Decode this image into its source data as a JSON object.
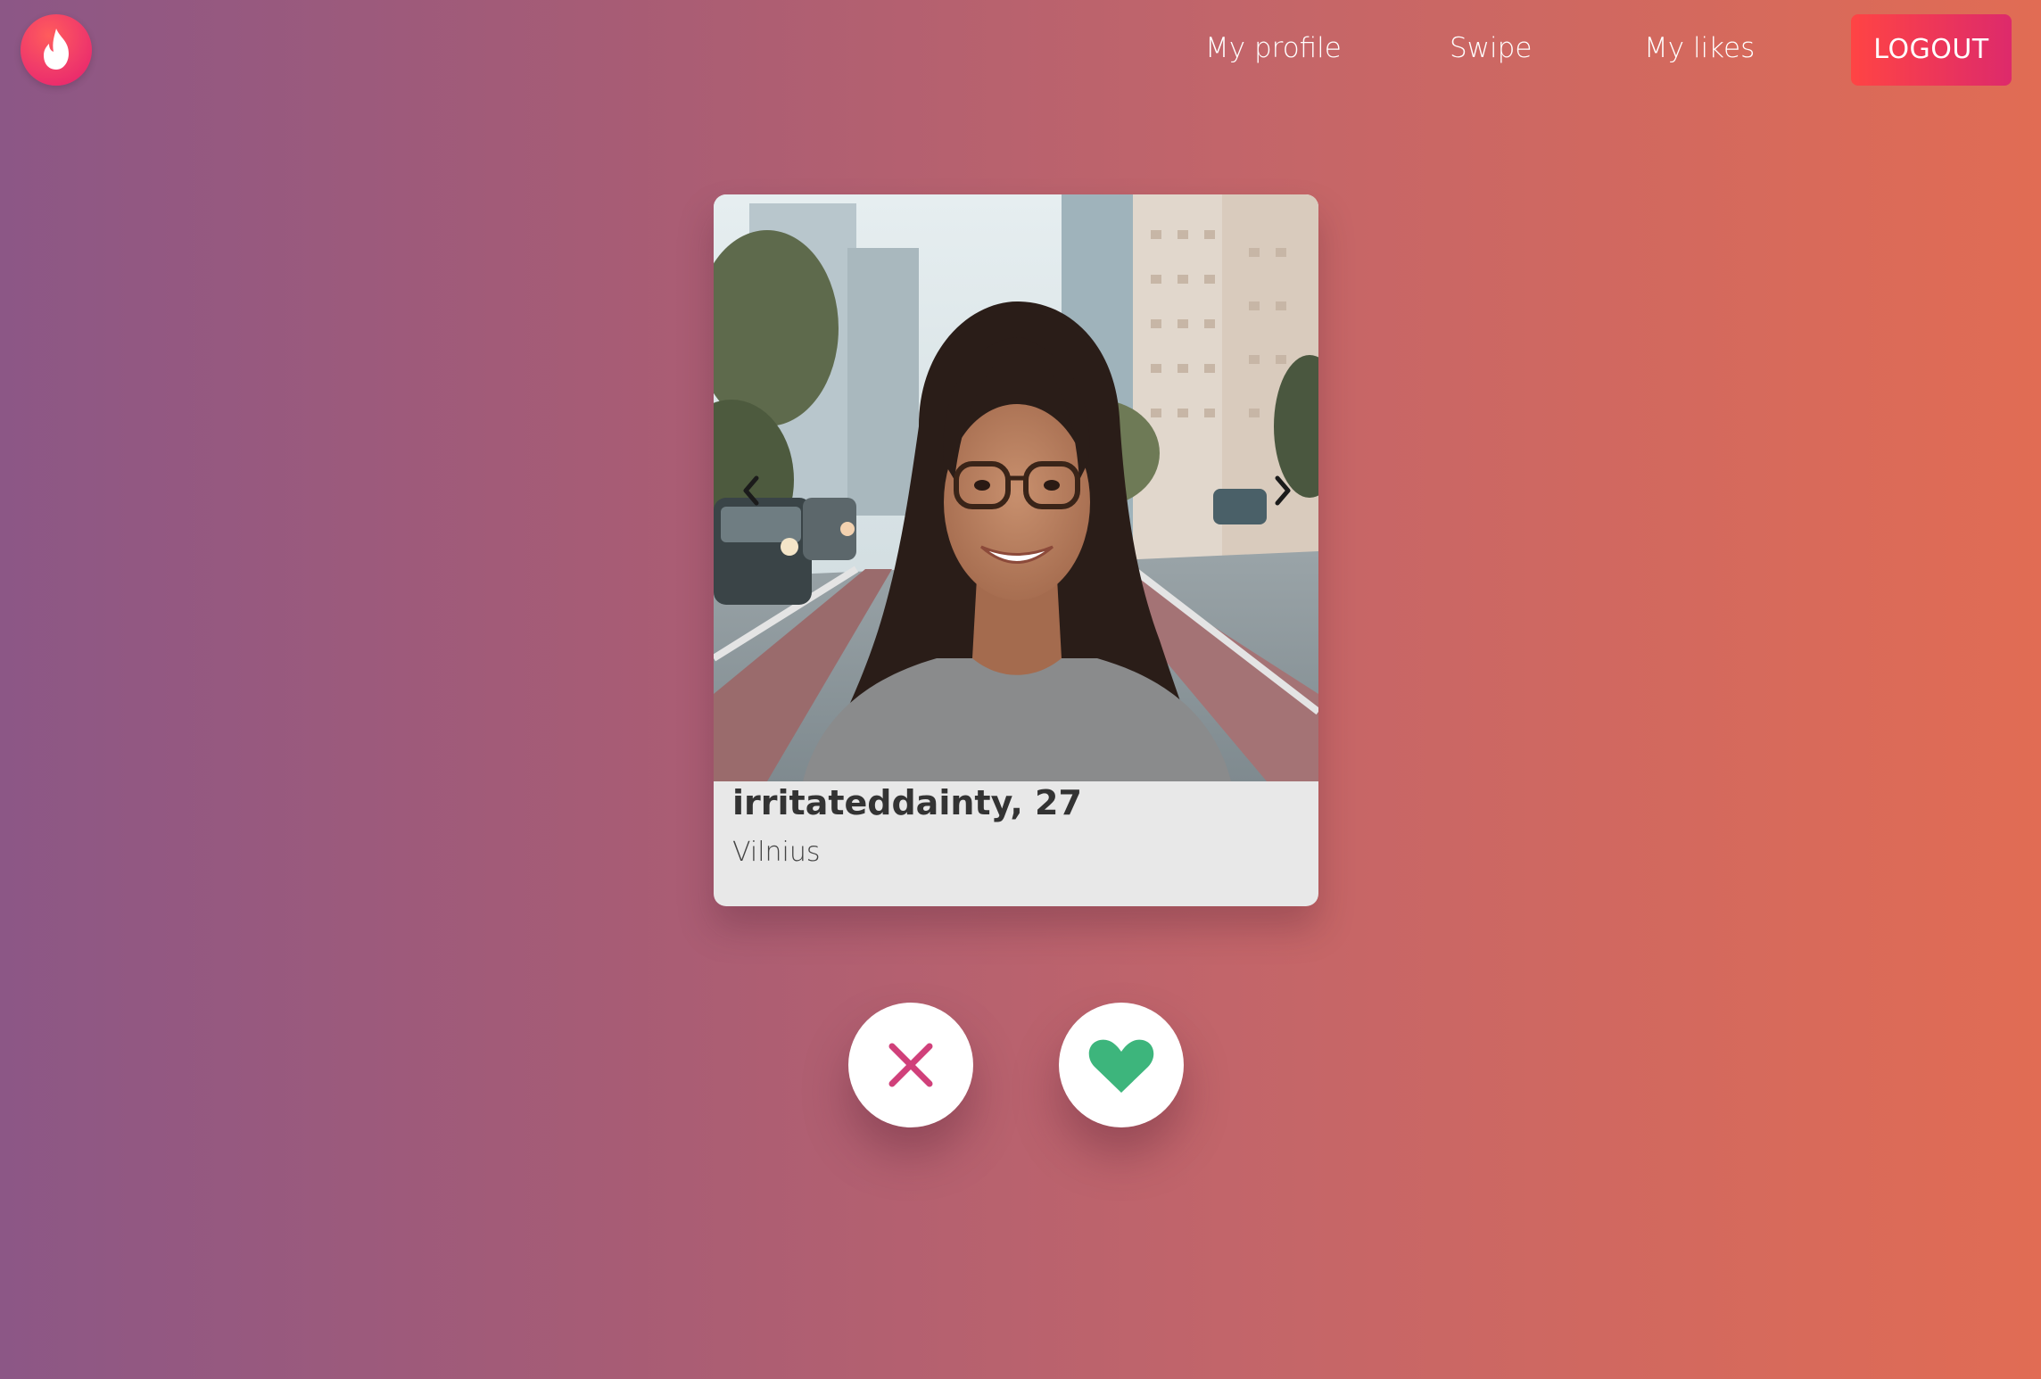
{
  "header": {
    "logo_icon": "flame-icon",
    "nav": [
      {
        "label": "My profile"
      },
      {
        "label": "Swipe"
      },
      {
        "label": "My likes"
      }
    ],
    "logout_label": "LOGOUT"
  },
  "card": {
    "photo_icon": "profile-photo",
    "name_age": "irritateddainty, 27",
    "city": "Vilnius",
    "prev_icon": "chevron-left-icon",
    "next_icon": "chevron-right-icon"
  },
  "actions": {
    "dislike_icon": "close-icon",
    "like_icon": "heart-icon"
  },
  "colors": {
    "background_left": "#8c5786",
    "background_right": "#e16c54",
    "logout_start": "#ff4444",
    "logout_end": "#dd2a6b",
    "dislike": "#d0407a",
    "like": "#3db57c"
  }
}
